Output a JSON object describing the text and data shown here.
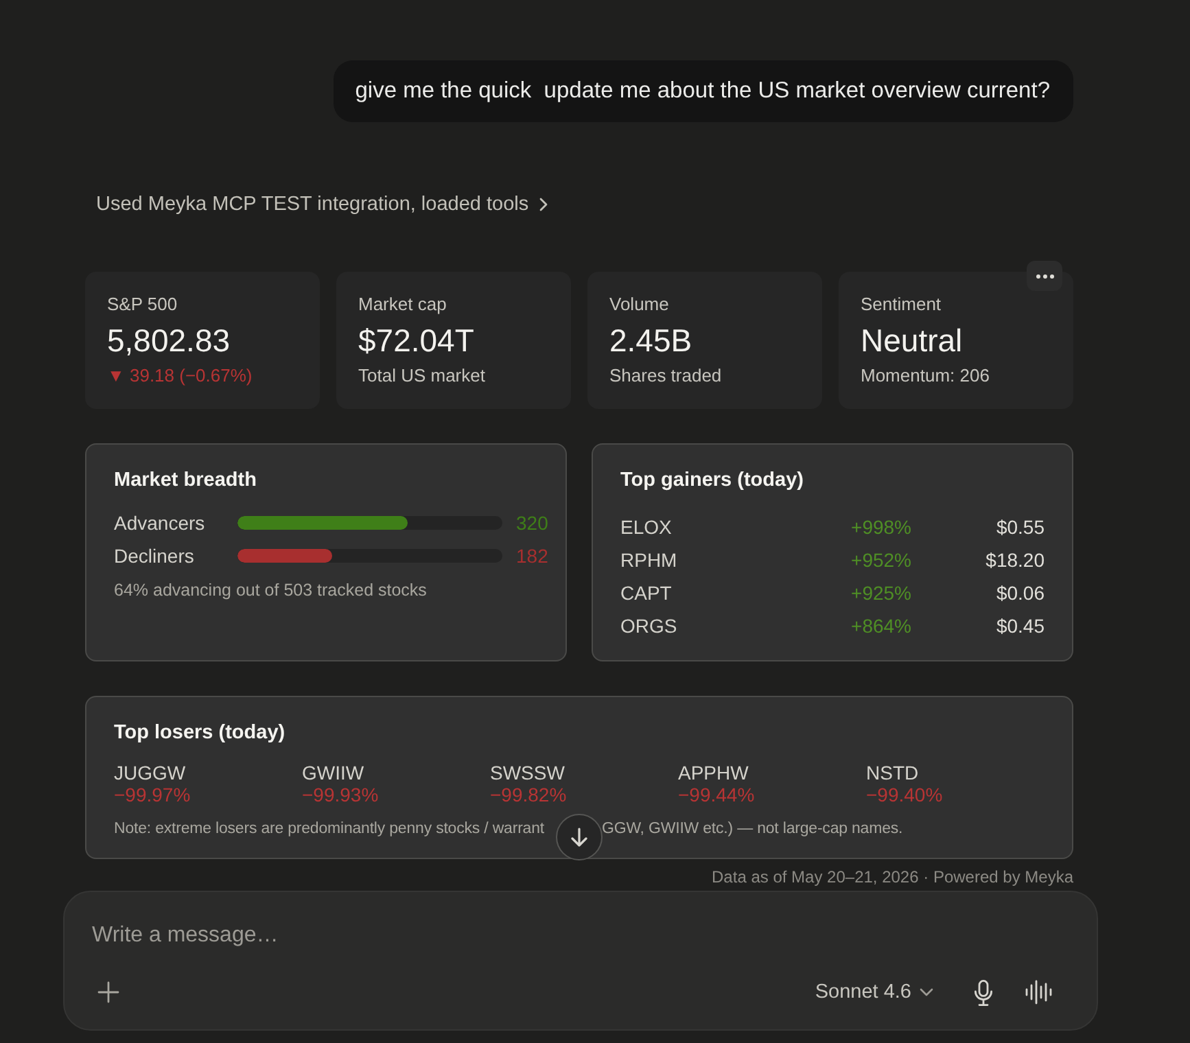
{
  "user_message": {
    "text": "give me the quick  update me about the US market overview current?"
  },
  "tool_use": {
    "label": "Used Meyka MCP TEST integration, loaded tools",
    "expanded": false
  },
  "stats": [
    {
      "label": "S&P 500",
      "value": "5,802.83",
      "sub": {
        "text": "▼ 39.18 (−0.67%)",
        "kind": "loss"
      }
    },
    {
      "label": "Market cap",
      "value": "$72.04T",
      "sub": {
        "text": "Total US market",
        "kind": "caption"
      }
    },
    {
      "label": "Volume",
      "value": "2.45B",
      "sub": {
        "text": "Shares traded",
        "kind": "caption"
      }
    },
    {
      "label": "Sentiment",
      "value": "Neutral",
      "sub": {
        "text": "Momentum: 206",
        "kind": "caption"
      }
    }
  ],
  "breadth": {
    "title": "Market breadth",
    "rows": [
      {
        "label": "Advancers",
        "level": 0.64,
        "count": "320",
        "color": "#3f7f18"
      },
      {
        "label": "Decliners",
        "level": 0.36,
        "count": "182",
        "color": "#a82f2f"
      }
    ],
    "summary": "64% advancing out of 503 tracked stocks"
  },
  "gainers": {
    "title": "Top gainers (today)",
    "rows": [
      {
        "ticker": "ELOX",
        "change": "+998%",
        "price": "$0.55"
      },
      {
        "ticker": "RPHM",
        "change": "+952%",
        "price": "$18.20"
      },
      {
        "ticker": "CAPT",
        "change": "+925%",
        "price": "$0.06"
      },
      {
        "ticker": "ORGS",
        "change": "+864%",
        "price": "$0.45"
      }
    ]
  },
  "losers": {
    "title": "Top losers (today)",
    "items": [
      {
        "ticker": "JUGGW",
        "change": "−99.97%"
      },
      {
        "ticker": "GWIIW",
        "change": "−99.93%"
      },
      {
        "ticker": "SWSSW",
        "change": "−99.82%"
      },
      {
        "ticker": "APPHW",
        "change": "−99.44%"
      },
      {
        "ticker": "NSTD",
        "change": "−99.40%"
      }
    ],
    "note": [
      "Note: extreme losers are predominantly penny stocks / warrant",
      "GGW, GWIIW etc.) — not large-cap names."
    ]
  },
  "footer_note": "Data as of May 20–21, 2026 · Powered by Meyka",
  "composer": {
    "placeholder": "Write a message…",
    "model": "Sonnet 4.6"
  }
}
